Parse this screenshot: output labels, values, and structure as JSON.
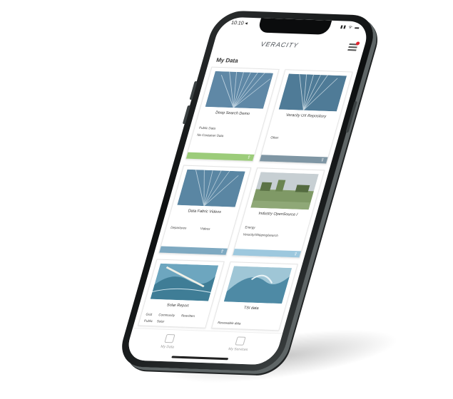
{
  "status_bar": {
    "time": "10:10 ◂",
    "icons": "▮▮ ᯤ ▬"
  },
  "header": {
    "logo": "VERACITY"
  },
  "page": {
    "title": "My Data"
  },
  "cards": [
    {
      "name": "Deep Search Demo",
      "meta": [
        "Public Data",
        "No Container Data"
      ],
      "bar_color": "#9ccc7a"
    },
    {
      "name": "Veracity UX Repository",
      "meta": [
        "Other"
      ],
      "bar_color": "#7f96a4"
    },
    {
      "name": "Data Fabric Videos",
      "meta": [
        "Departures",
        "Videos"
      ],
      "bar_color": "#7ea9c1"
    },
    {
      "name": "Industry OpenSource /",
      "meta": [
        "Energy",
        "Veracity/Shipping/search"
      ],
      "bar_color": "#9dc8de"
    },
    {
      "name": "Solar Report",
      "meta": [
        "Grid",
        "Community",
        "Rewritten",
        "Public",
        "Solar"
      ],
      "bar_color": ""
    },
    {
      "name": "TSI data",
      "meta": [
        "Renewable data"
      ],
      "bar_color": ""
    }
  ],
  "tabbar": {
    "tab1": "My Data",
    "tab2": "My Services"
  },
  "colors": {
    "accent_green": "#9ccc7a",
    "accent_blue": "#7ea9c1",
    "logo": "#4a4f55"
  },
  "icons": [
    "menu-icon",
    "notification-dot",
    "share-icon",
    "data-tab-icon",
    "services-tab-icon"
  ]
}
